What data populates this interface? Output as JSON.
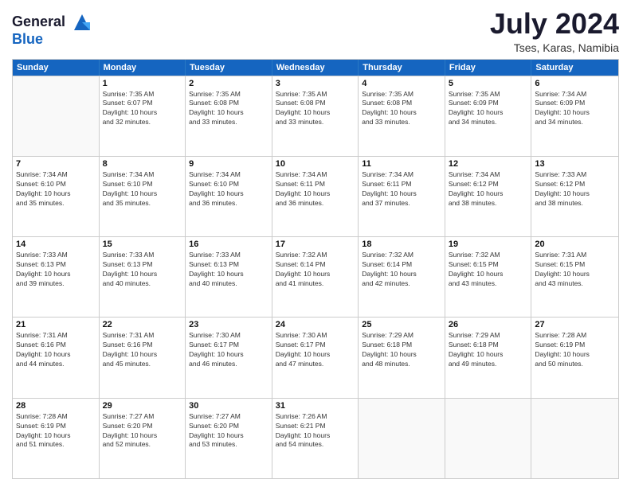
{
  "header": {
    "logo_line1": "General",
    "logo_line2": "Blue",
    "month_title": "July 2024",
    "location": "Tses, Karas, Namibia"
  },
  "calendar": {
    "days_of_week": [
      "Sunday",
      "Monday",
      "Tuesday",
      "Wednesday",
      "Thursday",
      "Friday",
      "Saturday"
    ],
    "weeks": [
      [
        {
          "day": "",
          "info": ""
        },
        {
          "day": "1",
          "info": "Sunrise: 7:35 AM\nSunset: 6:07 PM\nDaylight: 10 hours\nand 32 minutes."
        },
        {
          "day": "2",
          "info": "Sunrise: 7:35 AM\nSunset: 6:08 PM\nDaylight: 10 hours\nand 33 minutes."
        },
        {
          "day": "3",
          "info": "Sunrise: 7:35 AM\nSunset: 6:08 PM\nDaylight: 10 hours\nand 33 minutes."
        },
        {
          "day": "4",
          "info": "Sunrise: 7:35 AM\nSunset: 6:08 PM\nDaylight: 10 hours\nand 33 minutes."
        },
        {
          "day": "5",
          "info": "Sunrise: 7:35 AM\nSunset: 6:09 PM\nDaylight: 10 hours\nand 34 minutes."
        },
        {
          "day": "6",
          "info": "Sunrise: 7:34 AM\nSunset: 6:09 PM\nDaylight: 10 hours\nand 34 minutes."
        }
      ],
      [
        {
          "day": "7",
          "info": "Sunrise: 7:34 AM\nSunset: 6:10 PM\nDaylight: 10 hours\nand 35 minutes."
        },
        {
          "day": "8",
          "info": "Sunrise: 7:34 AM\nSunset: 6:10 PM\nDaylight: 10 hours\nand 35 minutes."
        },
        {
          "day": "9",
          "info": "Sunrise: 7:34 AM\nSunset: 6:10 PM\nDaylight: 10 hours\nand 36 minutes."
        },
        {
          "day": "10",
          "info": "Sunrise: 7:34 AM\nSunset: 6:11 PM\nDaylight: 10 hours\nand 36 minutes."
        },
        {
          "day": "11",
          "info": "Sunrise: 7:34 AM\nSunset: 6:11 PM\nDaylight: 10 hours\nand 37 minutes."
        },
        {
          "day": "12",
          "info": "Sunrise: 7:34 AM\nSunset: 6:12 PM\nDaylight: 10 hours\nand 38 minutes."
        },
        {
          "day": "13",
          "info": "Sunrise: 7:33 AM\nSunset: 6:12 PM\nDaylight: 10 hours\nand 38 minutes."
        }
      ],
      [
        {
          "day": "14",
          "info": "Sunrise: 7:33 AM\nSunset: 6:13 PM\nDaylight: 10 hours\nand 39 minutes."
        },
        {
          "day": "15",
          "info": "Sunrise: 7:33 AM\nSunset: 6:13 PM\nDaylight: 10 hours\nand 40 minutes."
        },
        {
          "day": "16",
          "info": "Sunrise: 7:33 AM\nSunset: 6:13 PM\nDaylight: 10 hours\nand 40 minutes."
        },
        {
          "day": "17",
          "info": "Sunrise: 7:32 AM\nSunset: 6:14 PM\nDaylight: 10 hours\nand 41 minutes."
        },
        {
          "day": "18",
          "info": "Sunrise: 7:32 AM\nSunset: 6:14 PM\nDaylight: 10 hours\nand 42 minutes."
        },
        {
          "day": "19",
          "info": "Sunrise: 7:32 AM\nSunset: 6:15 PM\nDaylight: 10 hours\nand 43 minutes."
        },
        {
          "day": "20",
          "info": "Sunrise: 7:31 AM\nSunset: 6:15 PM\nDaylight: 10 hours\nand 43 minutes."
        }
      ],
      [
        {
          "day": "21",
          "info": "Sunrise: 7:31 AM\nSunset: 6:16 PM\nDaylight: 10 hours\nand 44 minutes."
        },
        {
          "day": "22",
          "info": "Sunrise: 7:31 AM\nSunset: 6:16 PM\nDaylight: 10 hours\nand 45 minutes."
        },
        {
          "day": "23",
          "info": "Sunrise: 7:30 AM\nSunset: 6:17 PM\nDaylight: 10 hours\nand 46 minutes."
        },
        {
          "day": "24",
          "info": "Sunrise: 7:30 AM\nSunset: 6:17 PM\nDaylight: 10 hours\nand 47 minutes."
        },
        {
          "day": "25",
          "info": "Sunrise: 7:29 AM\nSunset: 6:18 PM\nDaylight: 10 hours\nand 48 minutes."
        },
        {
          "day": "26",
          "info": "Sunrise: 7:29 AM\nSunset: 6:18 PM\nDaylight: 10 hours\nand 49 minutes."
        },
        {
          "day": "27",
          "info": "Sunrise: 7:28 AM\nSunset: 6:19 PM\nDaylight: 10 hours\nand 50 minutes."
        }
      ],
      [
        {
          "day": "28",
          "info": "Sunrise: 7:28 AM\nSunset: 6:19 PM\nDaylight: 10 hours\nand 51 minutes."
        },
        {
          "day": "29",
          "info": "Sunrise: 7:27 AM\nSunset: 6:20 PM\nDaylight: 10 hours\nand 52 minutes."
        },
        {
          "day": "30",
          "info": "Sunrise: 7:27 AM\nSunset: 6:20 PM\nDaylight: 10 hours\nand 53 minutes."
        },
        {
          "day": "31",
          "info": "Sunrise: 7:26 AM\nSunset: 6:21 PM\nDaylight: 10 hours\nand 54 minutes."
        },
        {
          "day": "",
          "info": ""
        },
        {
          "day": "",
          "info": ""
        },
        {
          "day": "",
          "info": ""
        }
      ]
    ]
  }
}
